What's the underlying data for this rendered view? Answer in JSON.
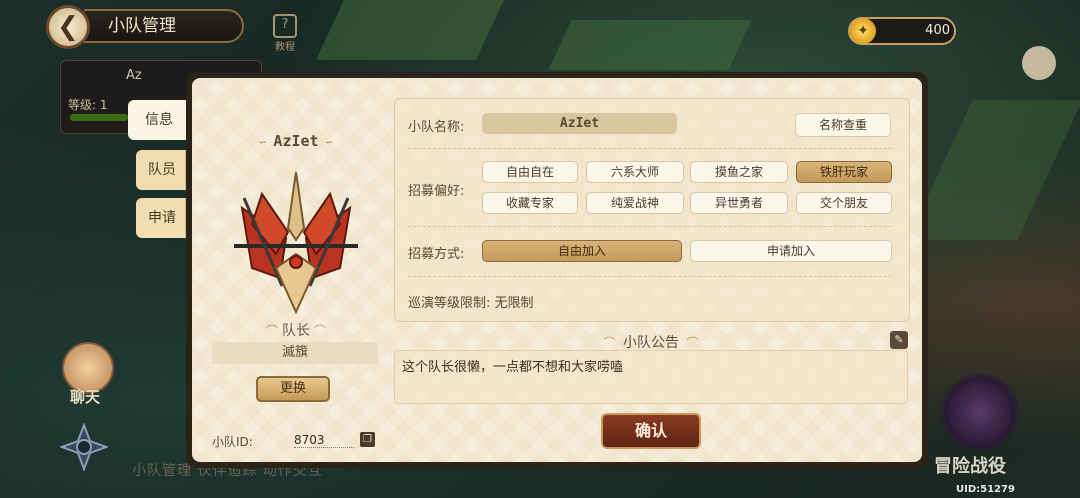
{
  "header": {
    "title": "小队管理",
    "tutorial_label": "教程",
    "currency": "400"
  },
  "background": {
    "team_name_partial": "Az",
    "level_label": "等级: 1",
    "chat_label": "聊天",
    "bottom_hint": "小队管理  伙伴追踪  动作交互",
    "adventure_label": "冒险战役",
    "uid": "UID:51279"
  },
  "tabs": [
    "信息",
    "队员",
    "申请"
  ],
  "team": {
    "name": "AzIet",
    "leader_label": "队长",
    "leader_name": "滅籏",
    "change_button": "更换",
    "id_label": "小队ID:",
    "id_value": "8703"
  },
  "form": {
    "name_label": "小队名称:",
    "name_value": "AzIet",
    "check_button": "名称查重",
    "pref_label": "招募偏好:",
    "prefs": [
      "自由自在",
      "六系大师",
      "摸鱼之家",
      "铁肝玩家",
      "收藏专家",
      "纯爱战神",
      "异世勇者",
      "交个朋友"
    ],
    "selected_pref": "铁肝玩家",
    "method_label": "招募方式:",
    "methods": [
      "自由加入",
      "申请加入"
    ],
    "selected_method": "自由加入",
    "level_limit": "巡演等级限制: 无限制"
  },
  "notice": {
    "title": "小队公告",
    "text": "这个队长很懒，一点都不想和大家唠嗑"
  },
  "confirm_label": "确认",
  "colors": {
    "accent": "#c39a5a",
    "confirm": "#7a2e1a",
    "panel": "#f6eedd"
  }
}
